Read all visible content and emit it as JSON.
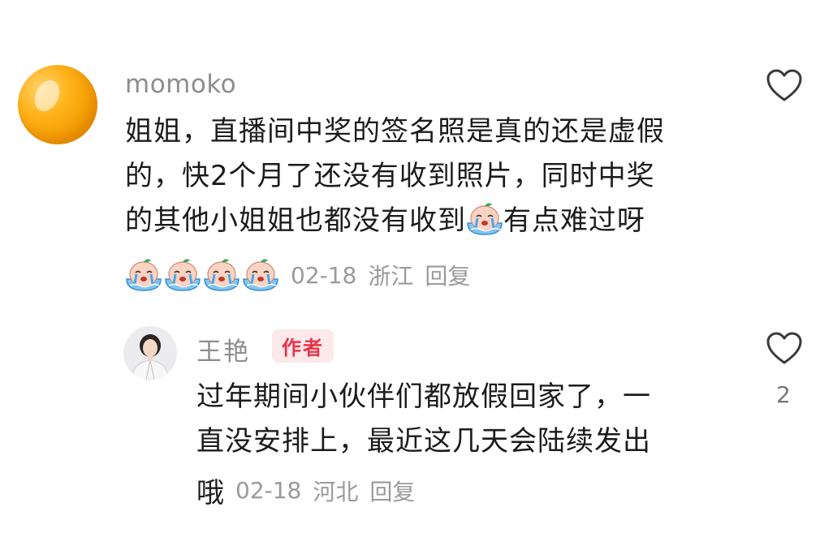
{
  "comment": {
    "username": "momoko",
    "lines": [
      "姐姐，直播间中奖的签名照是真的还是虚假",
      "的，快2个月了还没有收到照片，同时中奖",
      "的其他小姐姐也都没有收到"
    ],
    "line3_tail": "有点难过呀",
    "date": "02-18",
    "location": "浙江",
    "reply_label": "回复",
    "emoji_name": "crying-baby-emoji"
  },
  "reply": {
    "username": "王艳",
    "badge": "作者",
    "lines": [
      "过年期间小伙伴们都放假回家了，一",
      "直没安排上，最近这几天会陆续发出"
    ],
    "last_line_start": "哦",
    "date": "02-18",
    "location": "河北",
    "reply_label": "回复",
    "like_count": "2"
  },
  "colors": {
    "badge_bg": "#fde8ea",
    "badge_text": "#e8344a",
    "meta_text": "#9a9a9a"
  }
}
